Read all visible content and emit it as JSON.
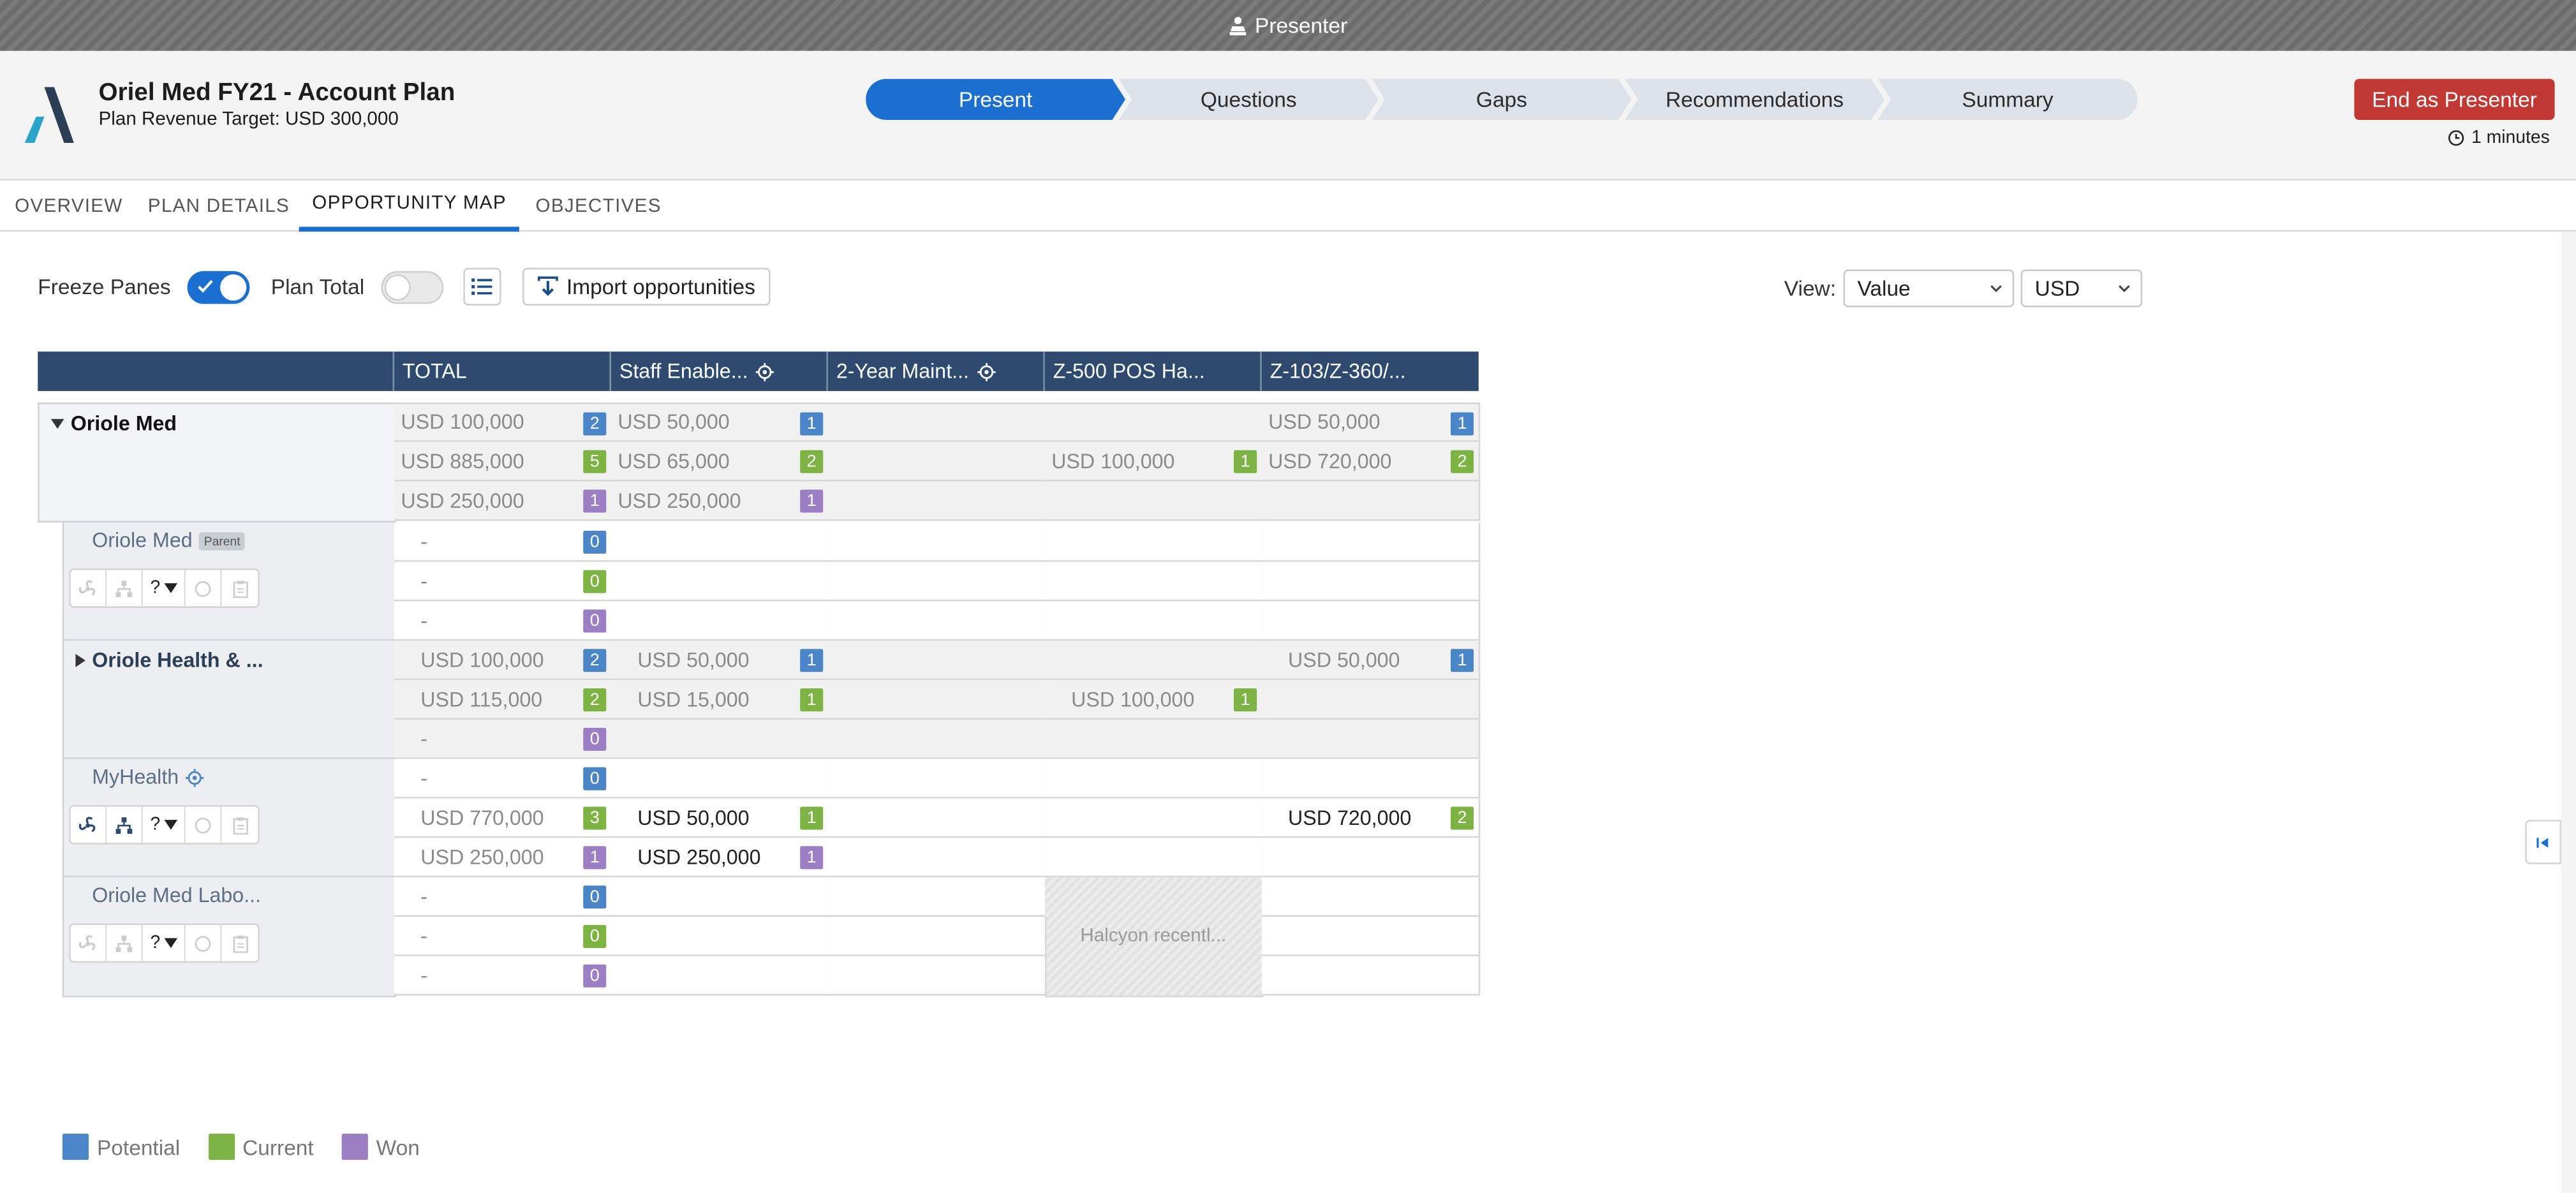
{
  "presenter_bar": {
    "label": "Presenter"
  },
  "header": {
    "title": "Oriel Med FY21 - Account Plan",
    "subtitle": "Plan Revenue Target: USD 300,000",
    "end_button": "End as Presenter",
    "timer": "1 minutes"
  },
  "stages": [
    {
      "label": "Present",
      "active": true
    },
    {
      "label": "Questions",
      "active": false
    },
    {
      "label": "Gaps",
      "active": false
    },
    {
      "label": "Recommendations",
      "active": false
    },
    {
      "label": "Summary",
      "active": false
    }
  ],
  "tabs": [
    {
      "label": "OVERVIEW"
    },
    {
      "label": "PLAN DETAILS"
    },
    {
      "label": "OPPORTUNITY MAP",
      "active": true
    },
    {
      "label": "OBJECTIVES"
    }
  ],
  "toolbar": {
    "freeze_panes_label": "Freeze Panes",
    "freeze_panes_on": true,
    "plan_total_label": "Plan Total",
    "plan_total_on": false,
    "import_label": "Import opportunities",
    "view_label": "View:",
    "view_value": "Value",
    "currency_value": "USD"
  },
  "grid": {
    "columns": [
      "TOTAL",
      "Staff Enable...",
      "2-Year Maint...",
      "Z-500 POS Ha...",
      "Z-103/Z-360/..."
    ],
    "oriole_med": {
      "name": "Oriole Med",
      "rows": [
        {
          "total": "USD 100,000",
          "total_n": "2",
          "c1": "USD 50,000",
          "c1_n": "1",
          "c4": "USD 50,000",
          "c4_n": "1"
        },
        {
          "total": "USD 885,000",
          "total_n": "5",
          "c1": "USD 65,000",
          "c1_n": "2",
          "c3": "USD 100,000",
          "c3_n": "1",
          "c4": "USD 720,000",
          "c4_n": "2"
        },
        {
          "total": "USD 250,000",
          "total_n": "1",
          "c1": "USD 250,000",
          "c1_n": "1"
        }
      ]
    },
    "oriole_med_parent": {
      "name": "Oriole Med",
      "badge": "Parent",
      "question_mark": "?",
      "rows": [
        {
          "total": "-",
          "total_n": "0"
        },
        {
          "total": "-",
          "total_n": "0"
        },
        {
          "total": "-",
          "total_n": "0"
        }
      ]
    },
    "oriole_health": {
      "name": "Oriole Health & ...",
      "rows": [
        {
          "total": "USD 100,000",
          "total_n": "2",
          "c1": "USD 50,000",
          "c1_n": "1",
          "c4": "USD 50,000",
          "c4_n": "1"
        },
        {
          "total": "USD 115,000",
          "total_n": "2",
          "c1": "USD 15,000",
          "c1_n": "1",
          "c3": "USD 100,000",
          "c3_n": "1"
        },
        {
          "total": "-",
          "total_n": "0"
        }
      ]
    },
    "myhealth": {
      "name": "MyHealth",
      "question_mark": "?",
      "rows": [
        {
          "total": "-",
          "total_n": "0"
        },
        {
          "total": "USD 770,000",
          "total_n": "3",
          "c1": "USD 50,000",
          "c1_n": "1",
          "c4": "USD 720,000",
          "c4_n": "2"
        },
        {
          "total": "USD 250,000",
          "total_n": "1",
          "c1": "USD 250,000",
          "c1_n": "1"
        }
      ]
    },
    "oriole_labo": {
      "name": "Oriole Med Labo...",
      "question_mark": "?",
      "note": "Halcyon recentl...",
      "rows": [
        {
          "total": "-",
          "total_n": "0"
        },
        {
          "total": "-",
          "total_n": "0"
        },
        {
          "total": "-",
          "total_n": "0"
        }
      ]
    }
  },
  "legend": [
    {
      "label": "Potential",
      "color": "#4a85c8"
    },
    {
      "label": "Current",
      "color": "#7cb342"
    },
    {
      "label": "Won",
      "color": "#9b7ec4"
    }
  ]
}
